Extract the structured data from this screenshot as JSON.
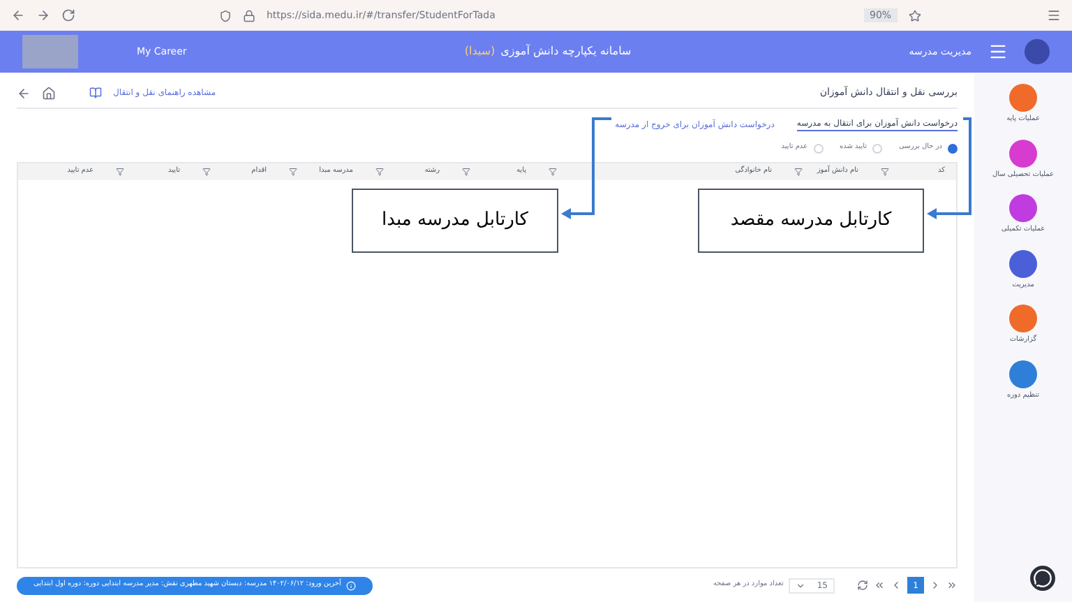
{
  "browser": {
    "url": "https://sida.medu.ir/#/transfer/StudentForTada",
    "zoom": "90%"
  },
  "header": {
    "title": "سامانه یکپارچه دانش آموزی",
    "badge": "(سیدا)",
    "user": "مدیریت مدرسه",
    "brand": "My Career"
  },
  "page": {
    "title": "بررسی نقل و انتقال دانش آموزان",
    "help_link": "مشاهده راهنمای نقل و انتقال"
  },
  "tabs": [
    {
      "label": "درخواست دانش آموزان برای انتقال به مدرسه",
      "selected": true
    },
    {
      "label": "درخواست دانش آموزان برای خروج از مدرسه",
      "selected": false
    }
  ],
  "filters": [
    {
      "label": "در حال بررسی",
      "selected": true
    },
    {
      "label": "تایید شده",
      "selected": false
    },
    {
      "label": "عدم تایید",
      "selected": false
    }
  ],
  "table": {
    "columns": [
      {
        "label": "کد",
        "filter": true
      },
      {
        "label": "نام دانش آموز",
        "filter": true
      },
      {
        "label": "نام خانوادگی",
        "filter": true
      },
      {
        "label": "پایه",
        "filter": true
      },
      {
        "label": "رشته",
        "filter": true
      },
      {
        "label": "مدرسه مبدا",
        "filter": true
      },
      {
        "label": "اقدام",
        "filter": true
      },
      {
        "label": "تایید",
        "filter": true
      },
      {
        "label": "عدم تایید",
        "filter": false
      }
    ]
  },
  "sidebar": {
    "items": [
      {
        "label": "عملیات پایه",
        "color": "#f06a2a"
      },
      {
        "label": "عملیات تحصیلی سال",
        "color": "#d83bd0"
      },
      {
        "label": "عملیات تکمیلی",
        "color": "#c03ce0"
      },
      {
        "label": "مدیریت",
        "color": "#4a5fd8"
      },
      {
        "label": "گزارشات",
        "color": "#f06a2a"
      },
      {
        "label": "تنظیم دوره",
        "color": "#2f7fd8"
      }
    ]
  },
  "callouts": [
    {
      "label": "کارتابل مدرسه مقصد"
    },
    {
      "label": "کارتابل مدرسه مبدا"
    }
  ],
  "pager": {
    "page": "1",
    "page_size": "15",
    "page_size_label": "تعداد موارد در هر صفحه"
  },
  "status_bar": {
    "text": "آخرین ورود: ۱۴۰۲/۰۶/۱۲ مدرسه: دبستان شهید مطهری نقش: مدیر مدرسه ابتدایی دوره: دوره اول ابتدایی"
  }
}
